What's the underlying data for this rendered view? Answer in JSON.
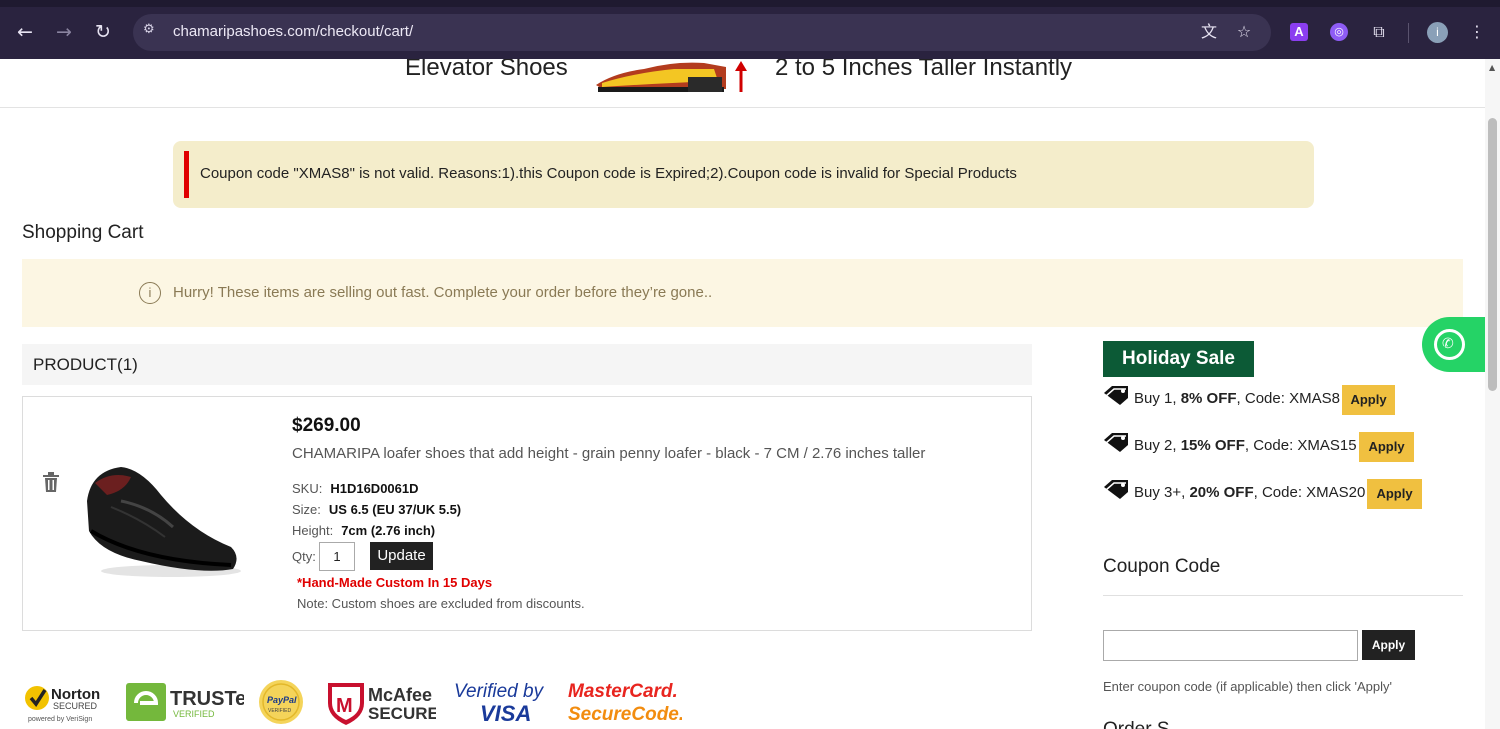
{
  "browser": {
    "url": "chamaripashoes.com/checkout/cart/",
    "profile_initial": "i",
    "ext_a_label": "A"
  },
  "banner": {
    "left_text": "Elevator Shoes",
    "right_text": "2 to 5 Inches Taller Instantly"
  },
  "error_message": "Coupon code \"XMAS8\" is not valid. Reasons:1).this Coupon code is Expired;2).Coupon code is invalid for Special Products",
  "cart": {
    "title": "Shopping Cart",
    "hurry_text": "Hurry! These items are selling out fast. Complete your order before they’re gone..",
    "product_header": "PRODUCT(1)",
    "item": {
      "price": "$269.00",
      "name": "CHAMARIPA loafer shoes that add height - grain penny loafer - black - 7 CM / 2.76 inches taller",
      "sku_label": "SKU:",
      "sku_value": "H1D16D0061D",
      "size_label": "Size:",
      "size_value": "US 6.5 (EU 37/UK 5.5)",
      "height_label": "Height:",
      "height_value": "7cm (2.76 inch)",
      "qty_label": "Qty:",
      "qty_value": "1",
      "update_label": "Update",
      "custom_note": "*Hand-Made Custom In 15 Days",
      "discount_note": "Note: Custom shoes are excluded from discounts."
    }
  },
  "promo": {
    "badge": "Holiday Sale",
    "deals": [
      {
        "pre": "Buy 1, ",
        "bold": "8% OFF",
        "post": ", Code: XMAS8",
        "button": "Apply"
      },
      {
        "pre": "Buy 2, ",
        "bold": "15% OFF",
        "post": ", Code: XMAS15",
        "button": "Apply"
      },
      {
        "pre": "Buy 3+, ",
        "bold": "20% OFF",
        "post": ", Code: XMAS20",
        "button": "Apply"
      }
    ]
  },
  "coupon": {
    "title": "Coupon Code",
    "input_value": "",
    "apply_label": "Apply",
    "hint": "Enter coupon code (if applicable) then click 'Apply'",
    "next_section_partial": "Order S"
  },
  "trust_badges": {
    "norton": "Norton",
    "norton_sub": "SECURED",
    "norton_powered": "powered by VeriSign",
    "truste": "TRUSTe",
    "truste_sub": "VERIFIED",
    "paypal": "PayPal",
    "paypal_sub": "VERIFIED",
    "mcafee": "McAfee",
    "mcafee_sub": "SECURE",
    "visa_top": "Verified by",
    "visa_bottom": "VISA",
    "mastercard_top": "MasterCard.",
    "mastercard_bottom": "SecureCode."
  },
  "colors": {
    "browser_bg": "#2a233f",
    "error_bg": "#f4edcb",
    "error_accent": "#e00000",
    "hurry_bg": "#fcf6e3",
    "holiday_green": "#0c5a36",
    "apply_yellow": "#f0c040",
    "whatsapp_green": "#25d366"
  }
}
